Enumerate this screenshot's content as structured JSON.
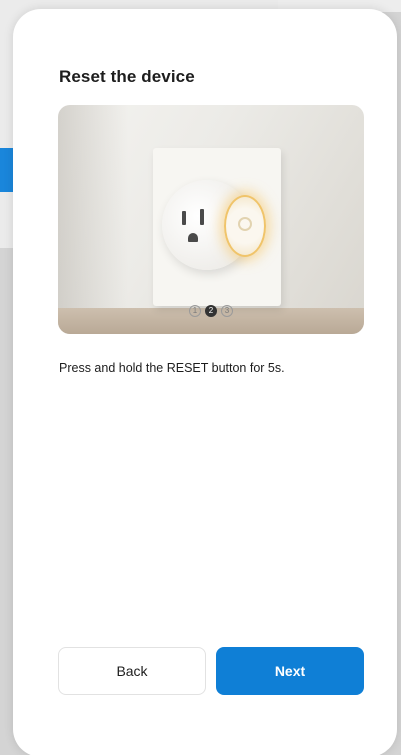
{
  "modal": {
    "title": "Reset the device",
    "instruction": "Press and hold the RESET button for 5s.",
    "steps": [
      {
        "label": "1",
        "active": false
      },
      {
        "label": "2",
        "active": true
      },
      {
        "label": "3",
        "active": false
      }
    ],
    "back_label": "Back",
    "next_label": "Next"
  },
  "colors": {
    "primary": "#0f7fd6",
    "text": "#1d1d1d",
    "glow": "#f0c46a"
  }
}
